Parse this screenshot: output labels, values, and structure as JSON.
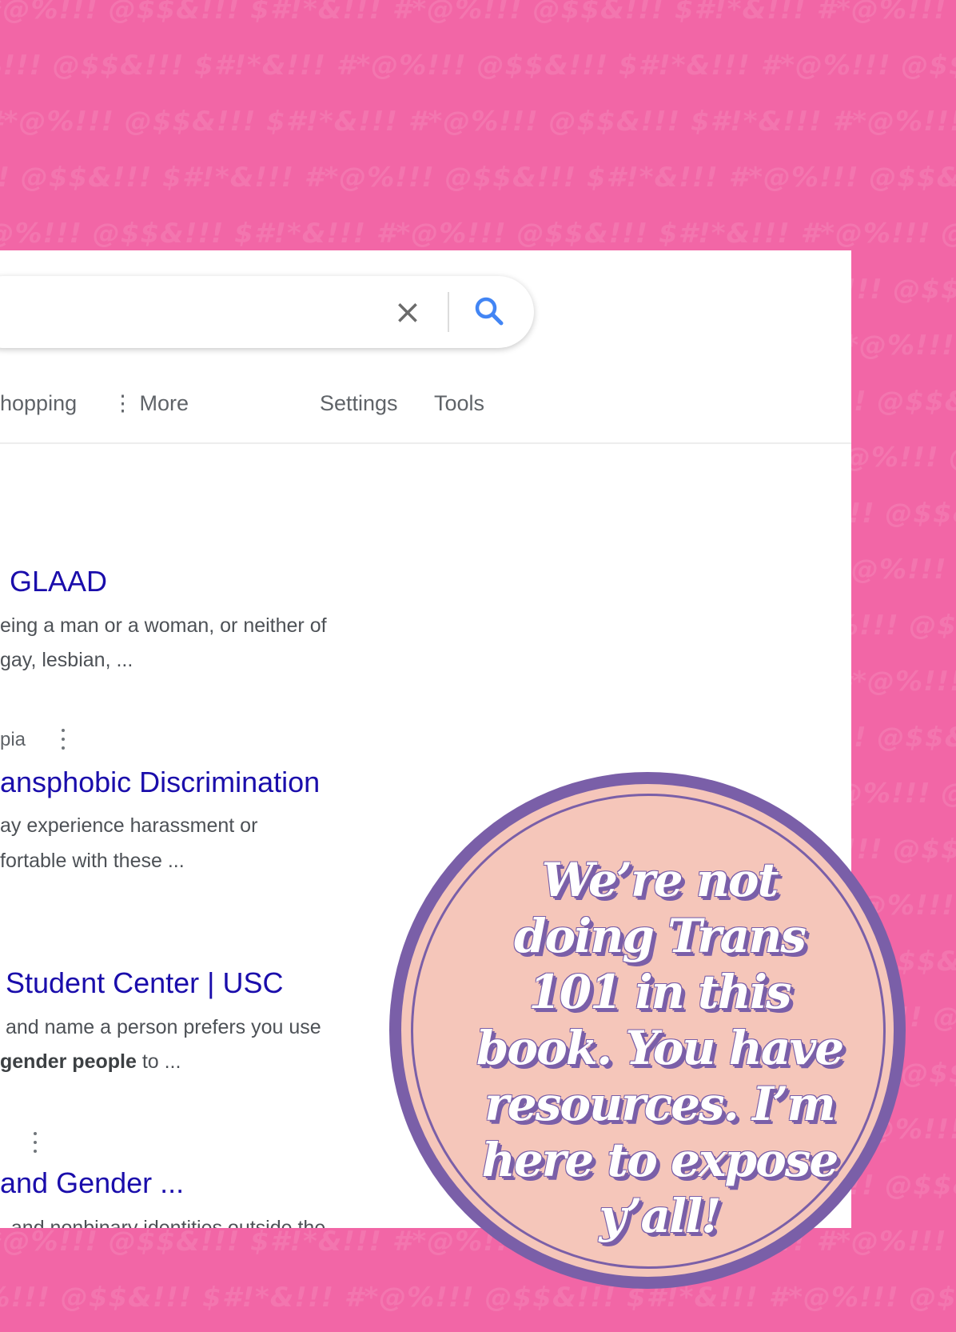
{
  "background_pattern": "#*@%!!! @$$&!!! $#!*&!!! #*@%!!! @$$&!!! $#!*&!!! #*@%!!! @$$&!!!",
  "colors": {
    "background": "#f266a6",
    "badge_border": "#7a5fa8",
    "badge_fill": "#f5c6ba",
    "link": "#1a0dab"
  },
  "search": {
    "clear_icon": "close-icon",
    "submit_icon": "search-icon"
  },
  "nav": {
    "shopping": "hopping",
    "more": "⋮ More",
    "settings": "Settings",
    "tools": "Tools"
  },
  "results": [
    {
      "title": "GLAAD",
      "snippet_1": "eing a man or a woman, or neither of",
      "snippet_2": "gay, lesbian, ..."
    },
    {
      "cite": "pia",
      "title": "ansphobic Discrimination",
      "snippet_1": "ay experience harassment or",
      "snippet_2": "fortable with these ..."
    },
    {
      "title": "Student Center | USC",
      "snippet_1": "and name a person prefers you use",
      "snippet_2_bold": "gender people",
      "snippet_2_rest": " to ..."
    },
    {
      "title": "and Gender ...",
      "snippet_1": ", and nonbinary identities outside the"
    }
  ],
  "badge": {
    "line_1": "We’re not",
    "line_2": "doing Trans",
    "line_3": "101 in this",
    "line_4": "book. You have",
    "line_5": "resources. I’m",
    "line_6": "here to expose",
    "line_7": "y’all!"
  }
}
